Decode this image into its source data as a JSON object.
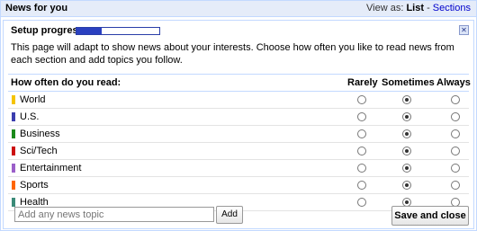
{
  "header": {
    "title": "News for you",
    "view_as_label": "View as:",
    "view_list": "List",
    "separator": "-",
    "view_sections": "Sections"
  },
  "setup": {
    "progress_label": "Setup progress:",
    "progress_fraction": 0.3,
    "close_glyph": "✕",
    "description": "This page will adapt to show news about your interests. Choose how often you like to read news from each section and add topics you follow."
  },
  "table": {
    "question": "How often do you read:",
    "columns": [
      "Rarely",
      "Sometimes",
      "Always"
    ],
    "rows": [
      {
        "name": "World",
        "color": "#f5c400",
        "selected": "Sometimes"
      },
      {
        "name": "U.S.",
        "color": "#3b3eae",
        "selected": "Sometimes"
      },
      {
        "name": "Business",
        "color": "#1b8a1b",
        "selected": "Sometimes"
      },
      {
        "name": "Sci/Tech",
        "color": "#cc1111",
        "selected": "Sometimes"
      },
      {
        "name": "Entertainment",
        "color": "#9b5fc9",
        "selected": "Sometimes"
      },
      {
        "name": "Sports",
        "color": "#ff6600",
        "selected": "Sometimes"
      },
      {
        "name": "Health",
        "color": "#3b8a78",
        "selected": "Sometimes"
      }
    ]
  },
  "footer": {
    "topic_placeholder": "Add any news topic",
    "add_label": "Add",
    "save_label": "Save and close"
  }
}
